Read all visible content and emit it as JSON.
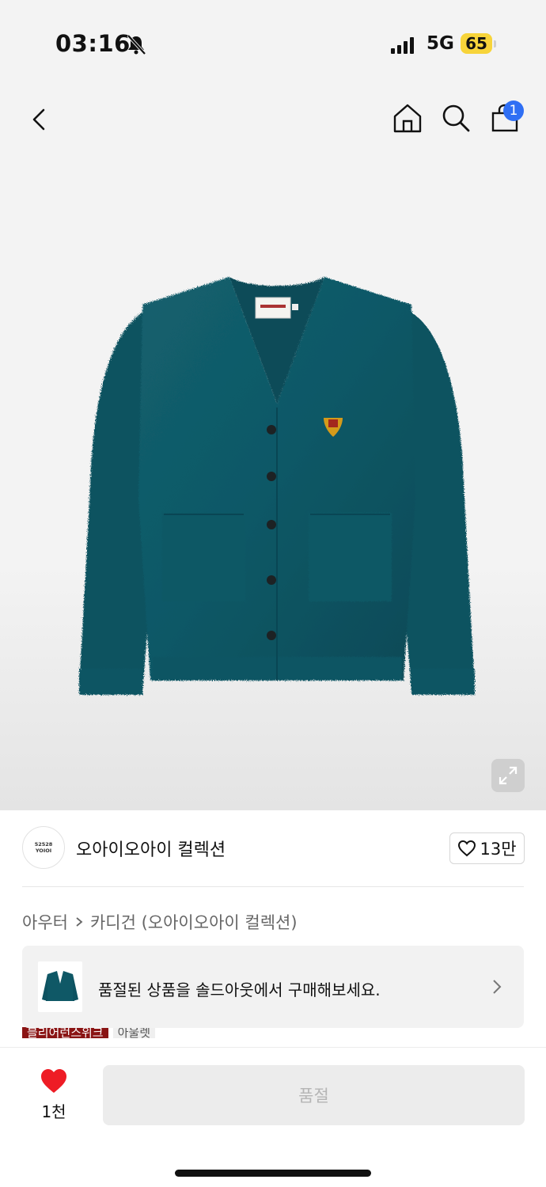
{
  "status_bar": {
    "time": "03:16",
    "network": "5G",
    "battery": "65"
  },
  "header": {
    "cart_count": "1",
    "icons": [
      "back-icon",
      "home-icon",
      "search-icon",
      "cart-icon"
    ]
  },
  "product": {
    "image_icon": "expand-icon",
    "colors": {
      "cardigan": "#0f5866",
      "accent": "#2f6ff4",
      "heart": "#ee1c25",
      "tag_red": "#8a1414"
    }
  },
  "brand": {
    "logo_line1": "52528",
    "logo_line2": "YOIOI",
    "name": "오아이오아이 컬렉션",
    "like_count": "13만"
  },
  "breadcrumb": {
    "category": "아우터",
    "subcategory": "카디건 (오아이오아이 컬렉션)"
  },
  "soldout_banner": {
    "text": "품절된 상품을 솔드아웃에서 구매해보세요."
  },
  "tags": [
    "블리어런스위크",
    "아울렛"
  ],
  "bottom_bar": {
    "wish_count": "1천",
    "buy_button_label": "품절"
  }
}
